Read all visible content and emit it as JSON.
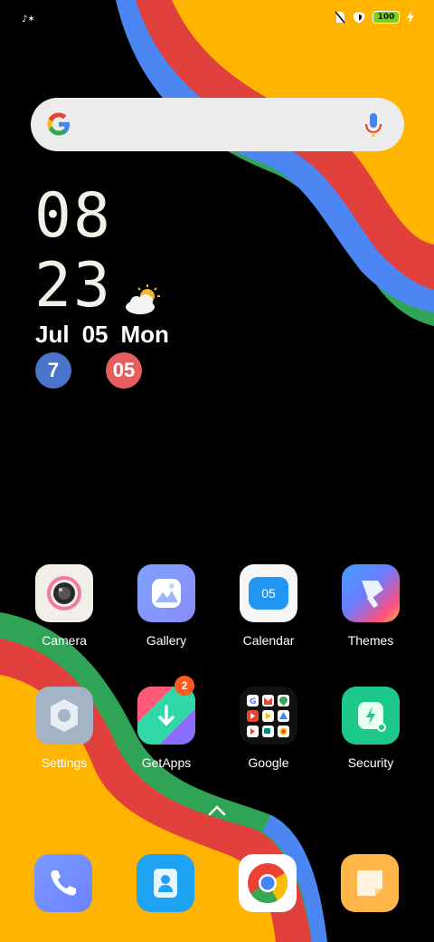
{
  "status_bar": {
    "notification_icon": "sparkle-icon",
    "battery_level": "100",
    "icons": [
      "no-sim-icon",
      "shield-icon",
      "battery-icon",
      "charging-bolt-icon"
    ]
  },
  "search_bar": {
    "left_icon": "google-logo-icon",
    "right_icon": "microphone-icon"
  },
  "clock": {
    "hour": "08",
    "minute": "23",
    "weather_icon": "partly-cloudy-icon",
    "month": "Jul",
    "day": "05",
    "weekday": "Mon",
    "circle_left": "7",
    "circle_right": "05"
  },
  "apps": [
    {
      "label": "Camera",
      "icon": "camera-icon"
    },
    {
      "label": "Gallery",
      "icon": "gallery-icon"
    },
    {
      "label": "Calendar",
      "icon": "calendar-icon",
      "icon_text": "05"
    },
    {
      "label": "Themes",
      "icon": "themes-icon"
    },
    {
      "label": "Settings",
      "icon": "settings-icon"
    },
    {
      "label": "GetApps",
      "icon": "getapps-icon",
      "badge": "2"
    },
    {
      "label": "Google",
      "icon": "google-folder-icon"
    },
    {
      "label": "Security",
      "icon": "security-icon"
    }
  ],
  "dock": [
    {
      "icon": "phone-icon"
    },
    {
      "icon": "contacts-icon"
    },
    {
      "icon": "chrome-icon"
    },
    {
      "icon": "notes-icon"
    }
  ],
  "colors": {
    "wallpaper_yellow": "#FFB400",
    "wallpaper_red": "#E2403C",
    "wallpaper_blue": "#4C86F2",
    "wallpaper_green": "#30A456"
  }
}
